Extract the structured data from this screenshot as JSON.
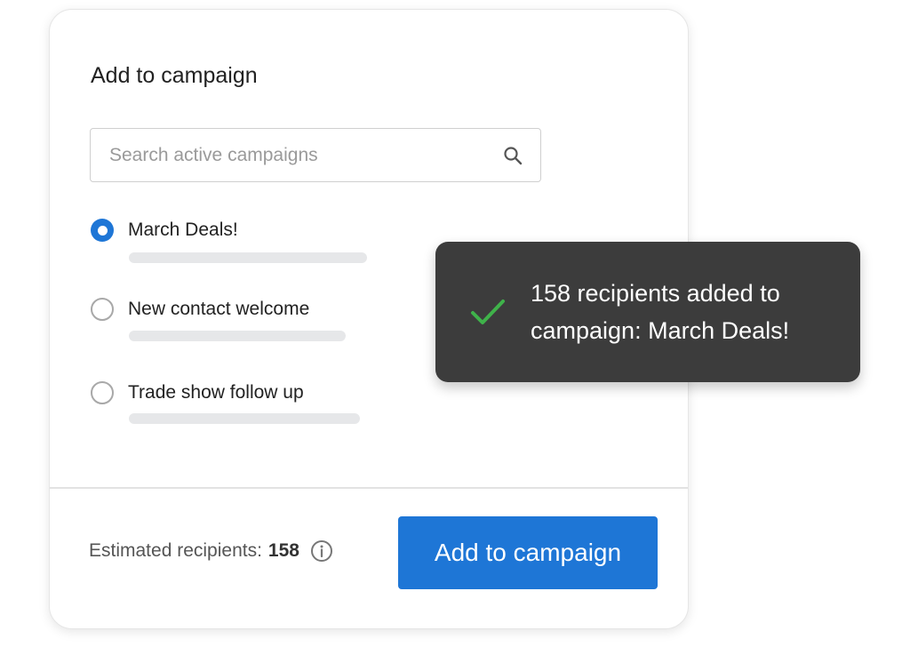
{
  "dialog": {
    "title": "Add to campaign",
    "search": {
      "placeholder": "Search active campaigns",
      "value": ""
    },
    "options": [
      {
        "label": "March Deals!",
        "selected": true
      },
      {
        "label": "New contact welcome",
        "selected": false
      },
      {
        "label": "Trade show follow up",
        "selected": false
      }
    ],
    "footer": {
      "estimate_label": "Estimated recipients:",
      "estimate_count": "158",
      "button_label": "Add to campaign"
    }
  },
  "toast": {
    "message": "158 recipients added to campaign: March Deals!"
  },
  "colors": {
    "accent": "#1e76d6",
    "toast_bg": "#3c3c3c",
    "success": "#3fb24a"
  },
  "icons": {
    "search": "search-icon",
    "info": "info-icon",
    "success": "check-icon"
  }
}
